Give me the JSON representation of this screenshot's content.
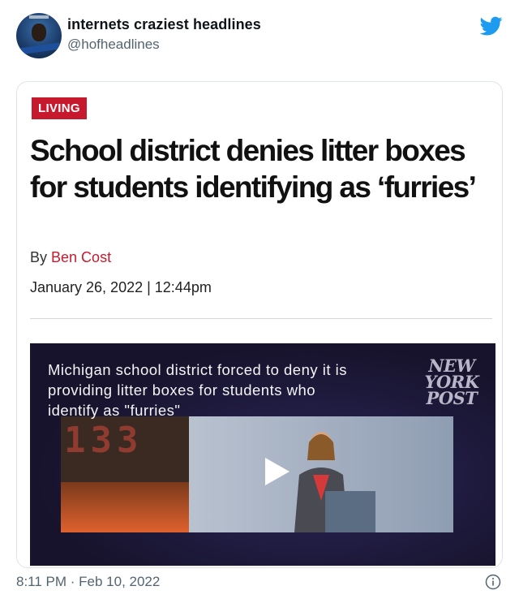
{
  "tweet": {
    "display_name": "internets craziest headlines",
    "handle": "@hofheadlines",
    "timestamp": "8:11 PM · Feb 10, 2022"
  },
  "icons": {
    "brand": "twitter-bird-icon",
    "info": "info-icon",
    "play": "play-icon"
  },
  "article": {
    "section": "LIVING",
    "headline": "School district denies litter boxes for students identifying as ‘furries’",
    "byline_prefix": "By",
    "author": "Ben Cost",
    "date": "January 26, 2022 | 12:44pm"
  },
  "video": {
    "caption": "Michigan school district forced to deny it is providing litter boxes for students who identify as \"furries\"",
    "logo": "NEW YORK POST"
  },
  "colors": {
    "brand_red": "#c7192d",
    "twitter_blue": "#1d9bf0",
    "muted_text": "#536471"
  }
}
